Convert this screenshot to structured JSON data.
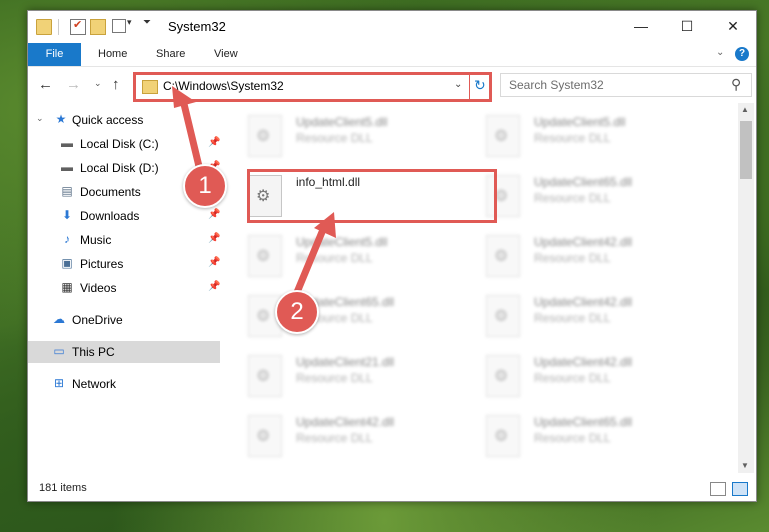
{
  "window": {
    "title": "System32",
    "minimize": "—",
    "maximize": "☐",
    "close": "✕"
  },
  "ribbon": {
    "tabs": [
      "File",
      "Home",
      "Share",
      "View"
    ],
    "expand": "⌄",
    "help": "?"
  },
  "nav": {
    "back": "←",
    "forward": "→",
    "recent": "⌄",
    "up": "↑",
    "address": "C:\\Windows\\System32",
    "address_dropdown": "⌄",
    "refresh": "↻",
    "search_placeholder": "Search System32",
    "search_icon": "⚲"
  },
  "sidebar": {
    "items": [
      {
        "label": "Quick access",
        "icon": "★",
        "icon_color": "#2b78d4",
        "pinned": false
      },
      {
        "label": "Local Disk (C:)",
        "icon": "▬",
        "icon_color": "#606060",
        "pinned": true
      },
      {
        "label": "Local Disk (D:)",
        "icon": "▬",
        "icon_color": "#606060",
        "pinned": true
      },
      {
        "label": "Documents",
        "icon": "▤",
        "icon_color": "#5a6f86",
        "pinned": true
      },
      {
        "label": "Downloads",
        "icon": "⬇",
        "icon_color": "#2b78d4",
        "pinned": true
      },
      {
        "label": "Music",
        "icon": "♪",
        "icon_color": "#2b78d4",
        "pinned": true
      },
      {
        "label": "Pictures",
        "icon": "▣",
        "icon_color": "#4a6f96",
        "pinned": true
      },
      {
        "label": "Videos",
        "icon": "▦",
        "icon_color": "#333333",
        "pinned": true
      },
      {
        "label": "OneDrive",
        "icon": "☁",
        "icon_color": "#2b78d4",
        "pinned": false
      },
      {
        "label": "This PC",
        "icon": "▭",
        "icon_color": "#3a7bd5",
        "pinned": false
      },
      {
        "label": "Network",
        "icon": "⊞",
        "icon_color": "#2b78d4",
        "pinned": false
      }
    ],
    "pin_glyph": "📌"
  },
  "files": {
    "type_label": "Resource DLL",
    "items": [
      {
        "name": "UpdateClient5.dll",
        "type": "Resource DLL"
      },
      {
        "name": "UpdateClient5.dll",
        "type": "Resource DLL"
      },
      {
        "name": "info_html.dll",
        "type": ""
      },
      {
        "name": "UpdateClient65.dll",
        "type": "Resource DLL"
      },
      {
        "name": "UpdateClient5.dll",
        "type": "Resource DLL"
      },
      {
        "name": "UpdateClient42.dll",
        "type": "Resource DLL"
      },
      {
        "name": "UpdateClient65.dll",
        "type": "Resource DLL"
      },
      {
        "name": "UpdateClient42.dll",
        "type": "Resource DLL"
      },
      {
        "name": "UpdateClient21.dll",
        "type": "Resource DLL"
      },
      {
        "name": "UpdateClient42.dll",
        "type": "Resource DLL"
      },
      {
        "name": "UpdateClient42.dll",
        "type": "Resource DLL"
      },
      {
        "name": "UpdateClient65.dll",
        "type": "Resource DLL"
      }
    ]
  },
  "status": {
    "item_count": "181 items"
  },
  "callouts": {
    "one": "1",
    "two": "2",
    "color": "#e05a55"
  }
}
